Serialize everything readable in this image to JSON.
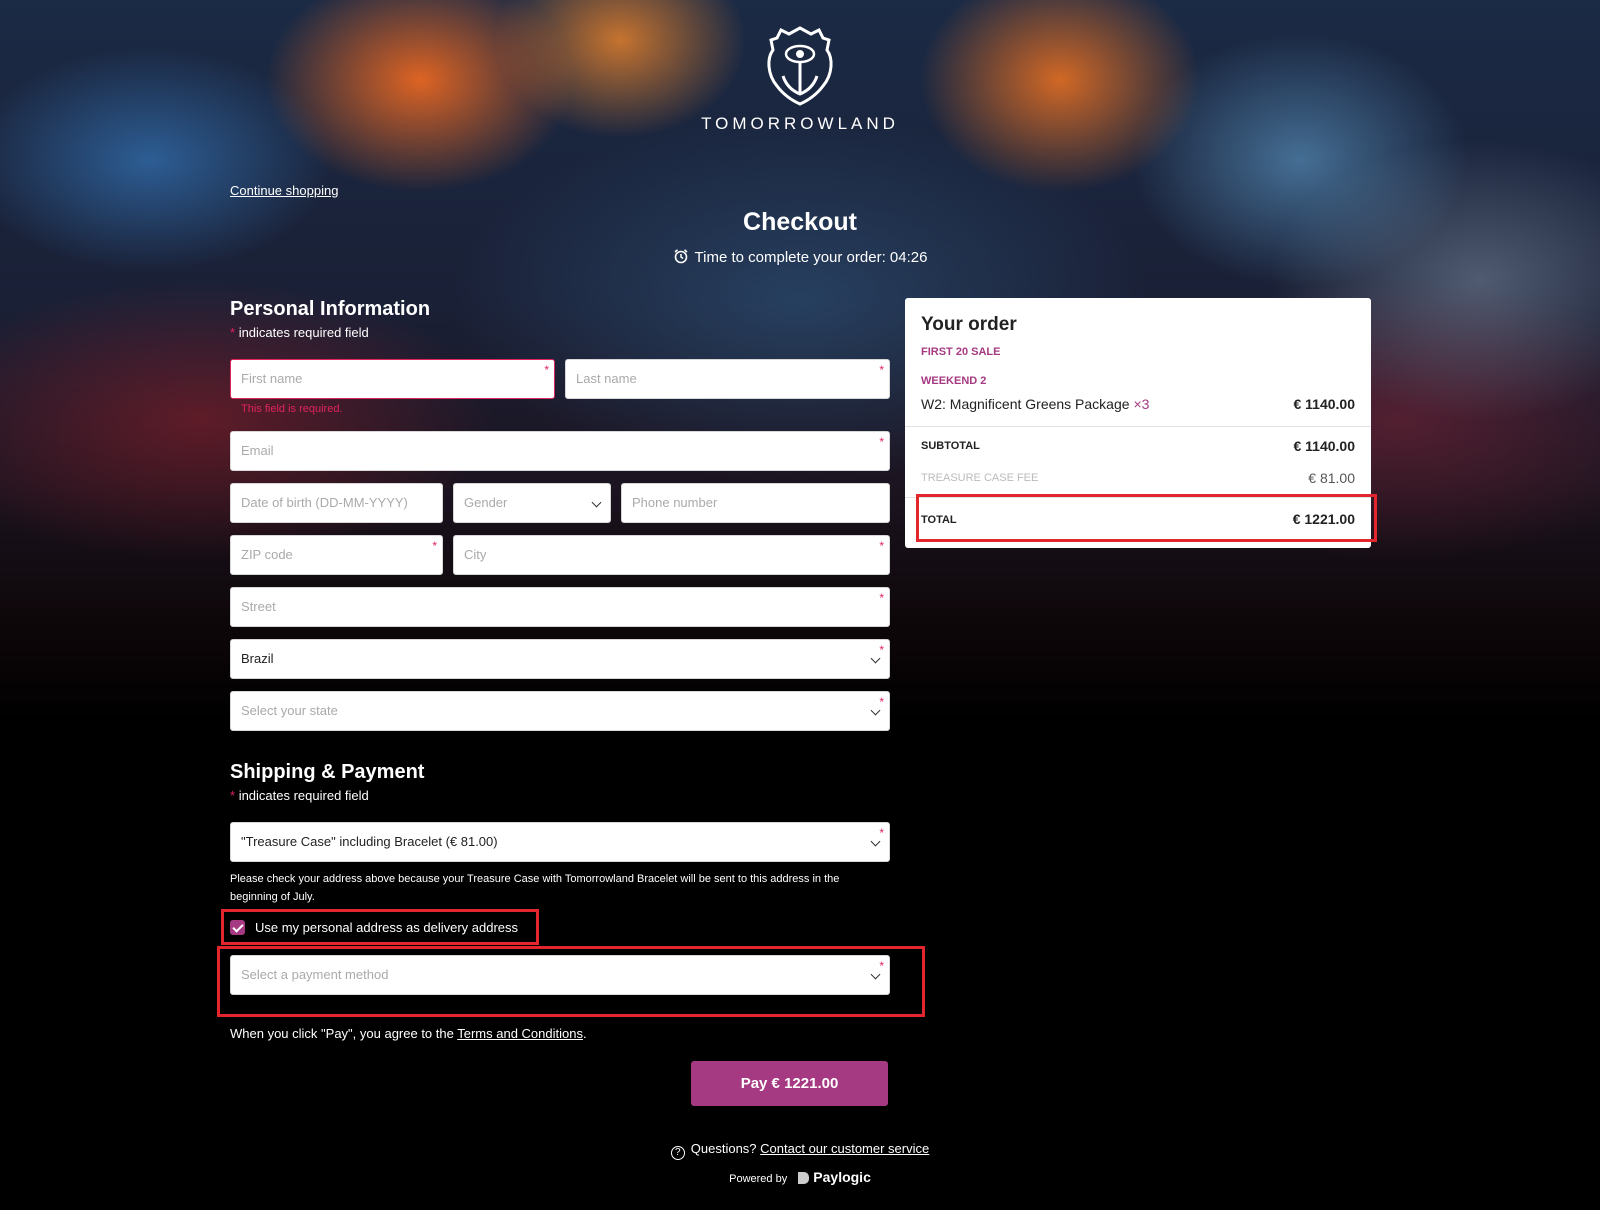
{
  "brand": {
    "name": "TOMORROWLAND",
    "logo_icon": "tomorrowland-logo-icon"
  },
  "nav": {
    "continue_shopping": "Continue shopping"
  },
  "header": {
    "title": "Checkout",
    "timer_label": "Time to complete your order: 04:26",
    "timer_icon": "alarm-clock-icon"
  },
  "personal": {
    "heading": "Personal Information",
    "required_note": "indicates required field",
    "first_name_placeholder": "First name",
    "first_name_error": "This field is required.",
    "last_name_placeholder": "Last name",
    "email_placeholder": "Email",
    "dob_placeholder": "Date of birth (DD-MM-YYYY)",
    "gender_placeholder": "Gender",
    "phone_placeholder": "Phone number",
    "zip_placeholder": "ZIP code",
    "city_placeholder": "City",
    "street_placeholder": "Street",
    "country_value": "Brazil",
    "state_placeholder": "Select your state"
  },
  "shipping": {
    "heading": "Shipping & Payment",
    "required_note": "indicates required field",
    "shipping_option": "\"Treasure Case\" including Bracelet (€ 81.00)",
    "notice": "Please check your address above because your Treasure Case with Tomorrowland Bracelet will be sent to this address in the beginning of July.",
    "use_personal_address_label": "Use my personal address as delivery address",
    "use_personal_address_checked": true,
    "payment_placeholder": "Select a payment method"
  },
  "terms": {
    "prefix": "When you click \"Pay\", you agree to the ",
    "link": "Terms and Conditions",
    "suffix": "."
  },
  "pay_button": "Pay € 1221.00",
  "footer": {
    "questions": "Questions?",
    "contact_link": "Contact our customer service",
    "powered_by": "Powered by",
    "provider": "Paylogic"
  },
  "order": {
    "heading": "Your order",
    "sale_label": "FIRST 20 SALE",
    "weekend_label": "WEEKEND 2",
    "item_name": "W2: Magnificent Greens Package",
    "item_qty": "×3",
    "item_price": "€ 1140.00",
    "subtotal_label": "SUBTOTAL",
    "subtotal_value": "€ 1140.00",
    "fee_label": "TREASURE CASE FEE",
    "fee_value": "€ 81.00",
    "total_label": "TOTAL",
    "total_value": "€ 1221.00"
  },
  "colors": {
    "accent": "#a63a82",
    "error": "#e0245e",
    "highlight_box": "#e3262e"
  }
}
